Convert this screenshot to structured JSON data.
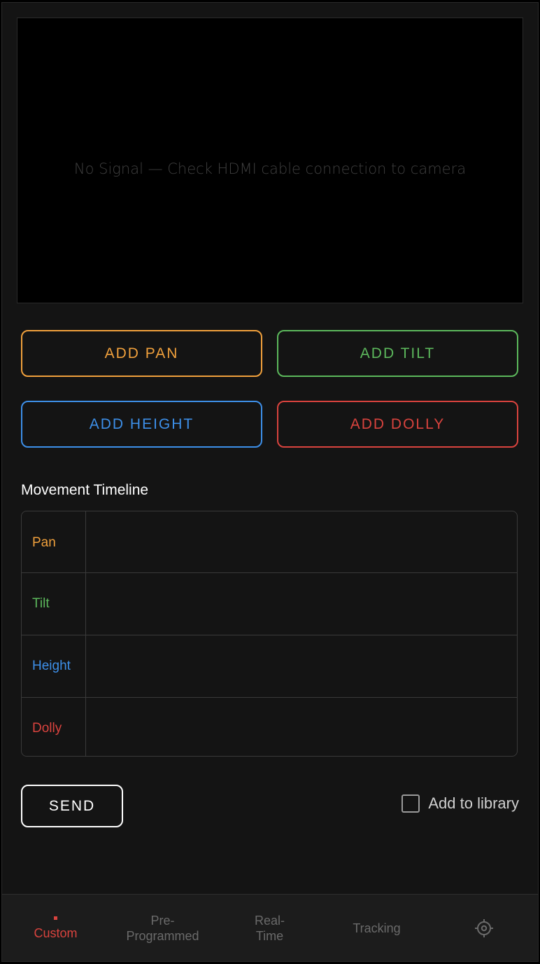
{
  "video": {
    "message": "No Signal — Check HDMI cable connection to camera"
  },
  "actions": {
    "pan": {
      "label": "ADD PAN",
      "color": "#f0a03c"
    },
    "tilt": {
      "label": "ADD TILT",
      "color": "#5cb85c"
    },
    "height": {
      "label": "ADD HEIGHT",
      "color": "#3d8fe8"
    },
    "dolly": {
      "label": "ADD DOLLY",
      "color": "#d9433e"
    }
  },
  "timeline": {
    "title": "Movement Timeline",
    "tracks": [
      {
        "label": "Pan",
        "color": "#f0a03c"
      },
      {
        "label": "Tilt",
        "color": "#5cb85c"
      },
      {
        "label": "Height",
        "color": "#3d8fe8"
      },
      {
        "label": "Dolly",
        "color": "#d9433e"
      }
    ]
  },
  "send": {
    "label": "SEND"
  },
  "library": {
    "label": "Add to library",
    "checked": false
  },
  "nav": {
    "items": [
      {
        "label": "Custom",
        "active": true
      },
      {
        "label": "Pre-\nProgrammed",
        "active": false
      },
      {
        "label": "Real-\nTime",
        "active": false
      },
      {
        "label": "Tracking",
        "active": false
      }
    ],
    "settings_icon": "gear-icon"
  }
}
